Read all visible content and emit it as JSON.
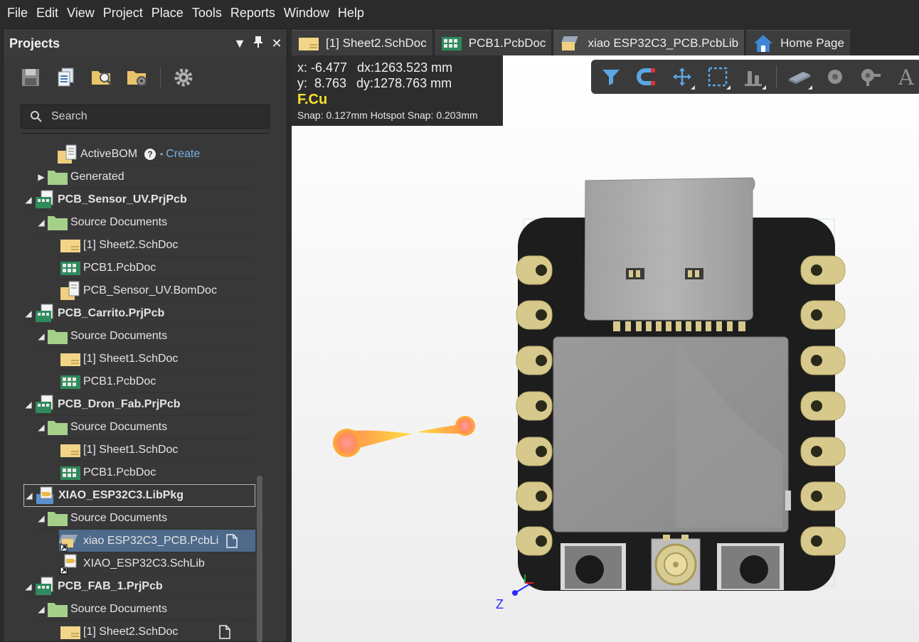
{
  "menu": [
    "File",
    "Edit",
    "View",
    "Project",
    "Place",
    "Tools",
    "Reports",
    "Window",
    "Help"
  ],
  "panel": {
    "title": "Projects",
    "search_placeholder": "Search"
  },
  "tree": {
    "activebom": "ActiveBOM",
    "create": "Create",
    "generated": "Generated",
    "p1": {
      "name": "PCB_Sensor_UV.PrjPcb",
      "src": "Source Documents",
      "d1": "[1] Sheet2.SchDoc",
      "d2": "PCB1.PcbDoc",
      "d3": "PCB_Sensor_UV.BomDoc"
    },
    "p2": {
      "name": "PCB_Carrito.PrjPcb",
      "src": "Source Documents",
      "d1": "[1] Sheet1.SchDoc",
      "d2": "PCB1.PcbDoc"
    },
    "p3": {
      "name": "PCB_Dron_Fab.PrjPcb",
      "src": "Source Documents",
      "d1": "[1] Sheet1.SchDoc",
      "d2": "PCB1.PcbDoc"
    },
    "p4": {
      "name": "XIAO_ESP32C3.LibPkg",
      "src": "Source Documents",
      "d1": "xiao ESP32C3_PCB.PcbLi",
      "d2": "XIAO_ESP32C3.SchLib"
    },
    "p5": {
      "name": "PCB_FAB_1.PrjPcb",
      "src": "Source Documents",
      "d1": "[1] Sheet2.SchDoc"
    }
  },
  "tabs": [
    "[1] Sheet2.SchDoc",
    "PCB1.PcbDoc",
    "xiao ESP32C3_PCB.PcbLib",
    "Home Page"
  ],
  "hud": {
    "x": "x: -6.477",
    "dx": "dx:1263.523 mm",
    "y": "y:  8.763",
    "dy": "dy:1278.763 mm",
    "layer": "F.Cu",
    "snap": "Snap: 0.127mm Hotspot Snap: 0.203mm"
  },
  "axis_label": "Z",
  "colors": {
    "accent": "#4d6a8a",
    "layer": "#ffe12a",
    "board": "#1d1d1d",
    "pad": "#d9c98a"
  }
}
